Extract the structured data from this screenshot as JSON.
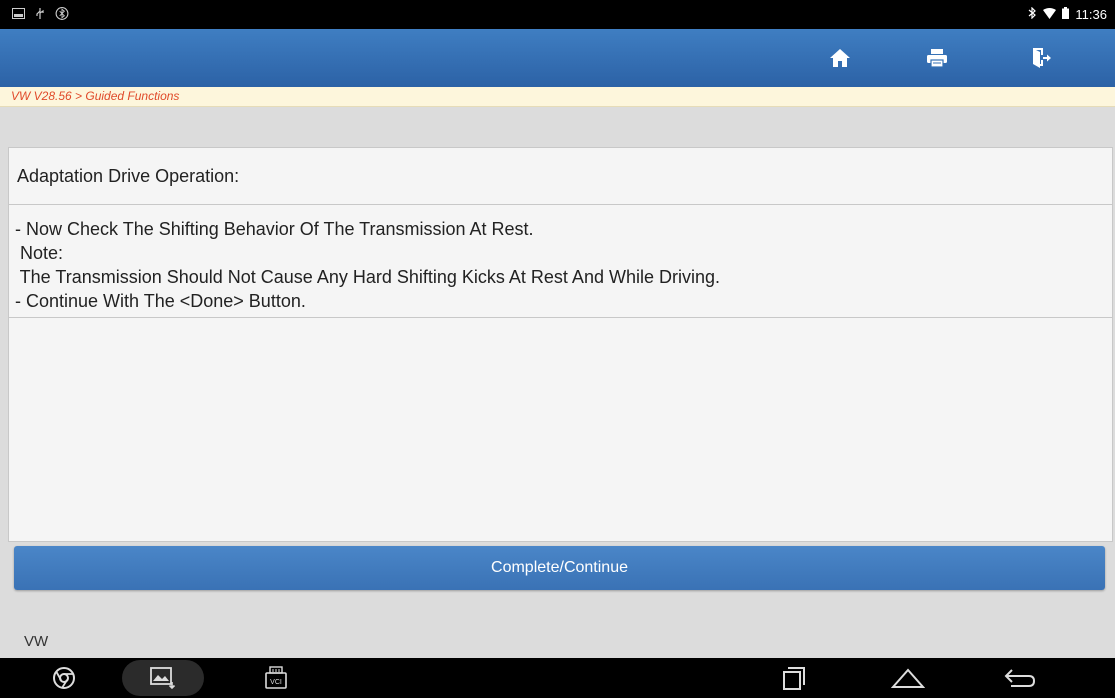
{
  "statusbar": {
    "time": "11:36"
  },
  "breadcrumb": {
    "text": "VW V28.56 > Guided Functions"
  },
  "content": {
    "heading": "Adaptation Drive Operation:",
    "lines": [
      "- Now Check The Shifting Behavior Of The Transmission At Rest.",
      " Note:",
      " The Transmission Should Not Cause Any Hard Shifting Kicks At Rest And While Driving.",
      "- Continue With The <Done> Button."
    ]
  },
  "action": {
    "label": "Complete/Continue"
  },
  "footer": {
    "label": "VW"
  },
  "nav": {
    "vci_label": "VCI"
  },
  "colors": {
    "titlebar": "#3470b4",
    "breadcrumb_text": "#e04a2a",
    "button": "#3f7bbf"
  }
}
